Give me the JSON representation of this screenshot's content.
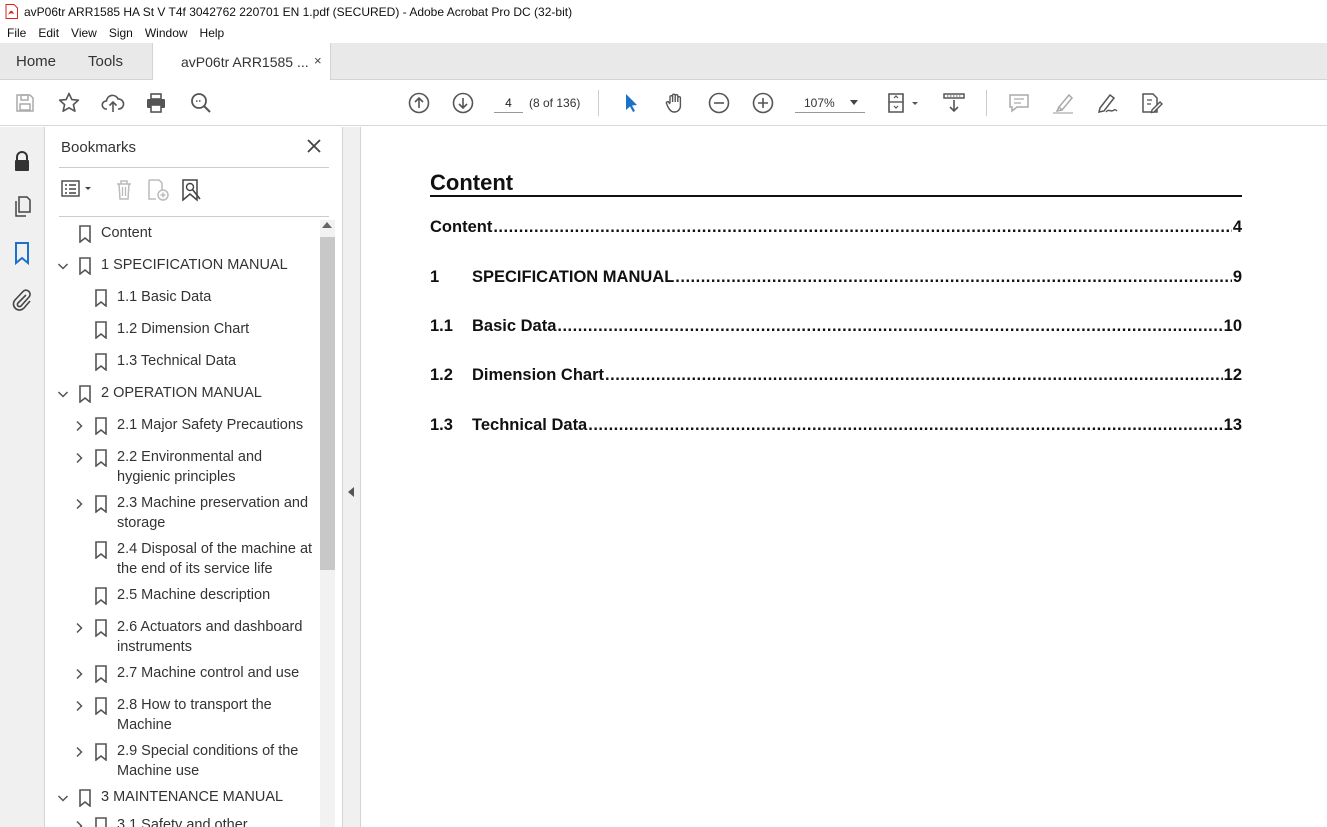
{
  "window": {
    "title": "avP06tr ARR1585 HA St V T4f 3042762 220701 EN 1.pdf (SECURED) - Adobe Acrobat Pro DC (32-bit)"
  },
  "menu": [
    "File",
    "Edit",
    "View",
    "Sign",
    "Window",
    "Help"
  ],
  "tabs": {
    "home": "Home",
    "tools": "Tools",
    "doc": "avP06tr ARR1585 ...",
    "close": "×"
  },
  "toolbar": {
    "page_value": "4",
    "page_count": "(8 of 136)",
    "zoom": "107%",
    "icons": [
      "save-icon",
      "bookmark-star-icon",
      "upload-icon",
      "print-icon",
      "find-icon",
      "page-up-icon",
      "page-down-icon",
      "select-pointer-icon",
      "hand-icon",
      "zoom-out-icon",
      "zoom-in-icon",
      "page-display-icon",
      "scroll-mode-icon",
      "comment-icon",
      "highlight-icon",
      "sign-icon",
      "edit-pdf-icon"
    ]
  },
  "bookmarks": {
    "title": "Bookmarks",
    "items": [
      {
        "label": "Content",
        "level": 0,
        "chevron": "none"
      },
      {
        "label": "1 SPECIFICATION MANUAL",
        "level": 0,
        "chevron": "down"
      },
      {
        "label": "1.1 Basic Data",
        "level": 1,
        "chevron": "none"
      },
      {
        "label": "1.2 Dimension Chart",
        "level": 1,
        "chevron": "none"
      },
      {
        "label": "1.3 Technical Data",
        "level": 1,
        "chevron": "none"
      },
      {
        "label": "2 OPERATION MANUAL",
        "level": 0,
        "chevron": "down"
      },
      {
        "label": "2.1 Major Safety Precautions",
        "level": 1,
        "chevron": "right"
      },
      {
        "label": "2.2 Environmental and",
        "label2": "hygienic principles",
        "level": 1,
        "chevron": "right"
      },
      {
        "label": "2.3 Machine preservation and",
        "label2": "storage",
        "level": 1,
        "chevron": "right"
      },
      {
        "label": "2.4 Disposal of the machine at",
        "label2": "the end of its service life",
        "level": 1,
        "chevron": "none"
      },
      {
        "label": "2.5 Machine description",
        "level": 1,
        "chevron": "none"
      },
      {
        "label": "2.6 Actuators and dashboard",
        "label2": "instruments",
        "level": 1,
        "chevron": "right"
      },
      {
        "label": "2.7 Machine control and use",
        "level": 1,
        "chevron": "right"
      },
      {
        "label": "2.8 How to transport the",
        "label2": "Machine",
        "level": 1,
        "chevron": "right"
      },
      {
        "label": "2.9 Special conditions of the",
        "label2": "Machine use",
        "level": 1,
        "chevron": "right"
      },
      {
        "label": "3 MAINTENANCE MANUAL",
        "level": 0,
        "chevron": "down"
      },
      {
        "label": "3.1 Safety and other",
        "level": 1,
        "chevron": "right"
      }
    ]
  },
  "document": {
    "heading": "Content",
    "toc": [
      {
        "num": "",
        "text": "Content",
        "page": "4"
      },
      {
        "num": "1",
        "text": "SPECIFICATION MANUAL",
        "page": "9"
      },
      {
        "num": "1.1",
        "text": "Basic Data",
        "page": "10"
      },
      {
        "num": "1.2",
        "text": "Dimension Chart",
        "page": "12"
      },
      {
        "num": "1.3",
        "text": "Technical Data",
        "page": "13"
      }
    ]
  },
  "colors": {
    "accent": "#1a73c9",
    "pdf_red": "#d9261c"
  }
}
